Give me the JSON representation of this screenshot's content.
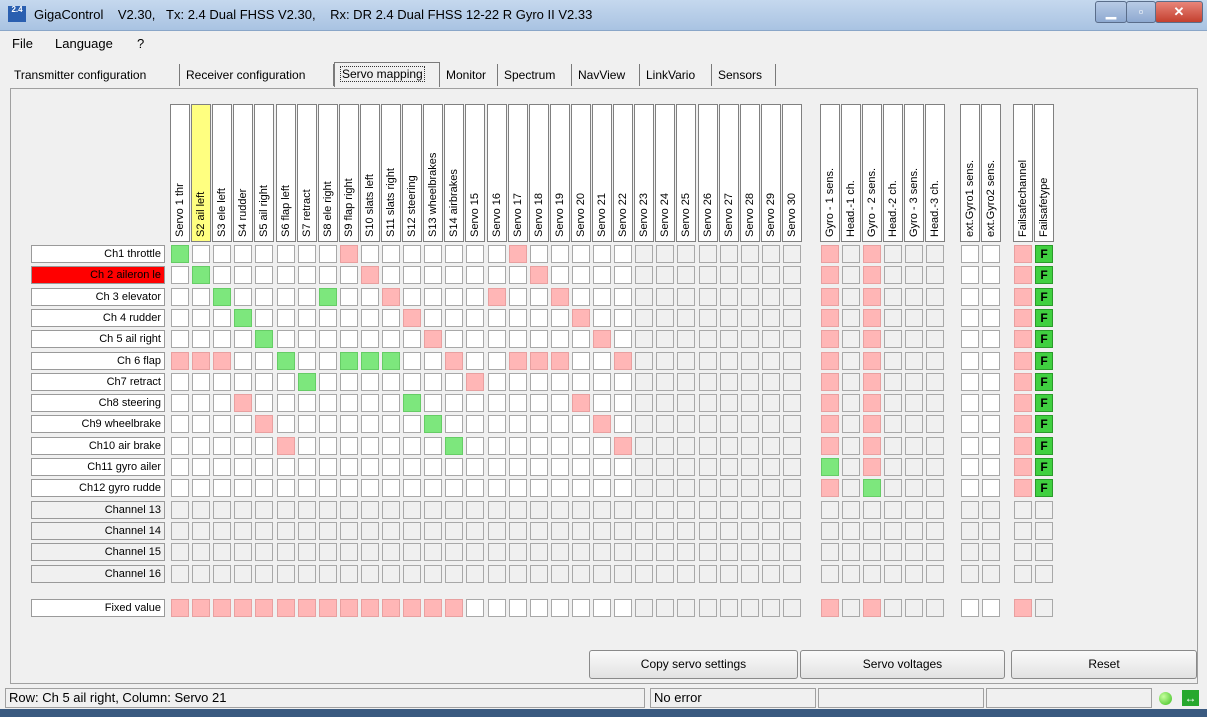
{
  "window": {
    "app_name": "GigaControl",
    "version": "V2.30,",
    "tx": "Tx: 2.4 Dual FHSS V2.30,",
    "rx": "Rx: DR 2.4 Dual FHSS 12-22 R Gyro II V2.33"
  },
  "menu": [
    "File",
    "Language",
    "?"
  ],
  "tabs": [
    "Transmitter configuration",
    "Receiver configuration",
    "Servo mapping",
    "Monitor",
    "Spectrum",
    "NavView",
    "LinkVario",
    "Sensors"
  ],
  "active_tab": "Servo mapping",
  "columns": [
    "Servo 1 thr",
    "S2 ail left",
    "S3 ele left",
    "S4 rudder",
    "S5 ail right",
    "S6 flap left",
    "S7 retract",
    "S8 ele right",
    "S9 flap right",
    "S10 slats left",
    "S11 slats right",
    "S12 steering",
    "S13 wheelbrakes",
    "S14 airbrakes",
    "Servo 15",
    "Servo 16",
    "Servo 17",
    "Servo 18",
    "Servo 19",
    "Servo 20",
    "Servo 21",
    "Servo 22",
    "Servo 23",
    "Servo 24",
    "Servo 25",
    "Servo 26",
    "Servo 27",
    "Servo 28",
    "Servo 29",
    "Servo 30",
    "Gyro - 1 sens.",
    "Head.-1 ch.",
    "Gyro - 2 sens.",
    "Head.-2 ch.",
    "Gyro - 3 sens.",
    "Head.-3 ch.",
    "ext.Gyro1 sens.",
    "ext.Gyro2 sens.",
    "Failsafechannel",
    "Failsafetype"
  ],
  "highlighted_column": "S2 ail left",
  "rows": [
    "Ch1 throttle",
    "Ch 2 aileron le",
    "Ch 3 elevator",
    "Ch 4 rudder",
    "Ch 5 ail right",
    "Ch 6 flap",
    "Ch7 retract",
    "Ch8 steering",
    "Ch9 wheelbrake",
    "Ch10 air brake",
    "Ch11 gyro ailer",
    "Ch12 gyro rudde",
    "Channel 13",
    "Channel 14",
    "Channel 15",
    "Channel 16"
  ],
  "highlighted_row": "Ch 2 aileron le",
  "fixed_row_label": "Fixed value",
  "failsafe_type_letter": "F",
  "colors": {
    "assigned": "#7de77d",
    "available": "#ffb6b6",
    "highlight_row": "#ff0000",
    "highlight_col": "#ffff80"
  },
  "buttons": {
    "copy": "Copy servo settings",
    "voltages": "Servo voltages",
    "reset": "Reset"
  },
  "status": {
    "cell_info": "Row: Ch 5 ail right, Column: Servo 21",
    "error": "No error"
  }
}
